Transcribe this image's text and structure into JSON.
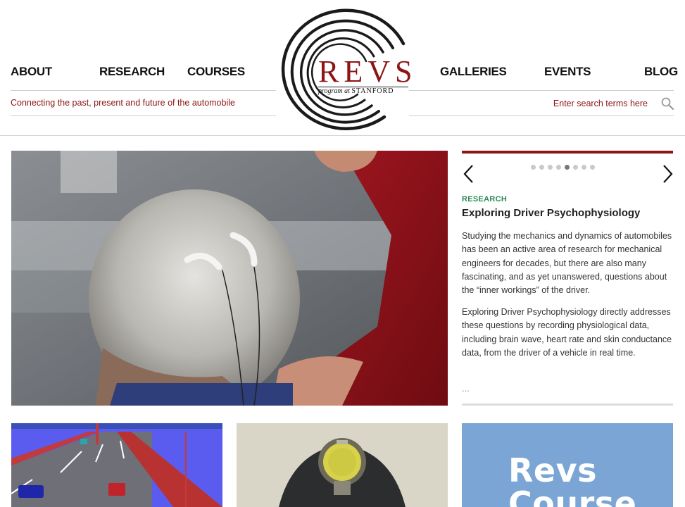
{
  "nav": {
    "items": [
      {
        "id": "about",
        "label": "ABOUT"
      },
      {
        "id": "research",
        "label": "RESEARCH"
      },
      {
        "id": "courses",
        "label": "COURSES"
      },
      {
        "id": "galleries",
        "label": "GALLERIES"
      },
      {
        "id": "events",
        "label": "EVENTS"
      },
      {
        "id": "blog",
        "label": "BLOG"
      }
    ]
  },
  "tagline": "Connecting the past, present and future of the automobile",
  "search": {
    "placeholder": "Enter search terms here",
    "icon": "magnifier-icon"
  },
  "logo": {
    "word": "REVS",
    "sub_italic": "program at",
    "sub_caps": "STANFORD",
    "color": "#8c1515"
  },
  "slideshow": {
    "dot_count": 8,
    "active_index": 4,
    "category": "RESEARCH",
    "title": "Exploring Driver Psychophysiology",
    "paragraphs": [
      "Studying the mechanics and dynamics of automobiles has been an active area of research for mechanical engineers for decades, but there are also many fascinating, and as yet unanswered, questions about the “inner workings” of the driver.",
      "Exploring Driver Psychophysiology directly addresses these questions by recording physiological data, including brain wave, heart rate and skin conductance data, from the driver of a vehicle in real time."
    ],
    "more": "...",
    "prev_icon": "chevron-left-icon",
    "next_icon": "chevron-right-icon"
  },
  "tiles": [
    {
      "id": "driving-sim",
      "icon": "driving-simulator-image"
    },
    {
      "id": "headlamp",
      "icon": "headlamp-image"
    },
    {
      "id": "course",
      "text_lines": [
        "Revs",
        "Course"
      ]
    }
  ],
  "colors": {
    "accent": "#8c1515",
    "category_green": "#2a8a55",
    "tile_blue": "#7aa5d4"
  }
}
